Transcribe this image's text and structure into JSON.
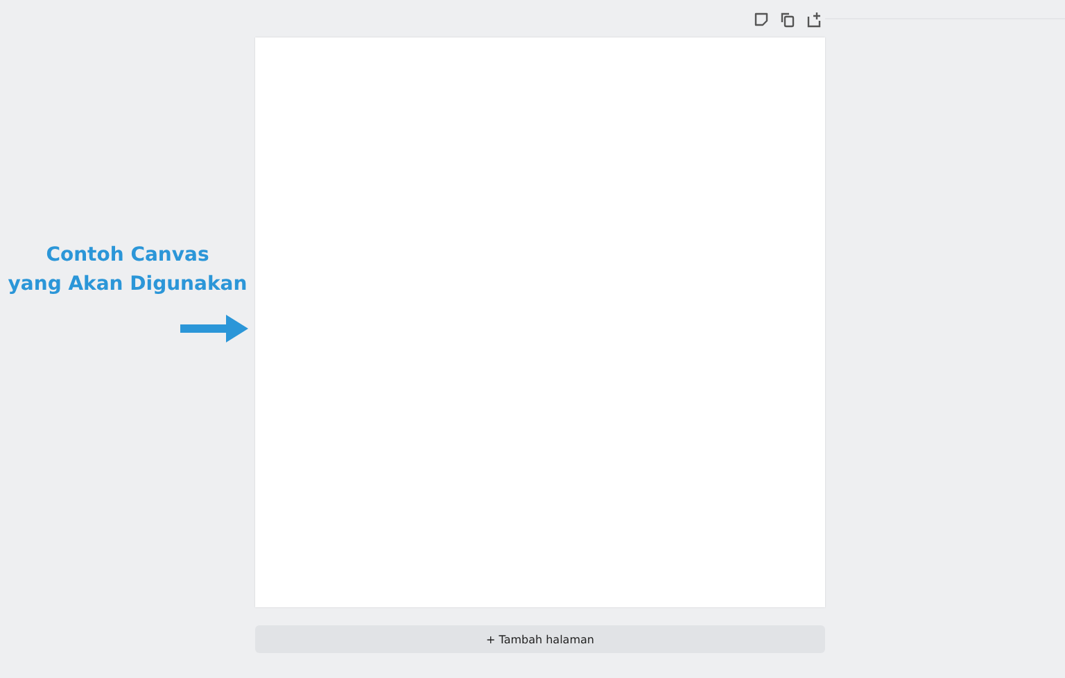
{
  "annotation": {
    "lines": [
      "Contoh Canvas",
      "yang Akan Digunakan"
    ]
  },
  "add_page_button": {
    "label": "+ Tambah halaman"
  }
}
